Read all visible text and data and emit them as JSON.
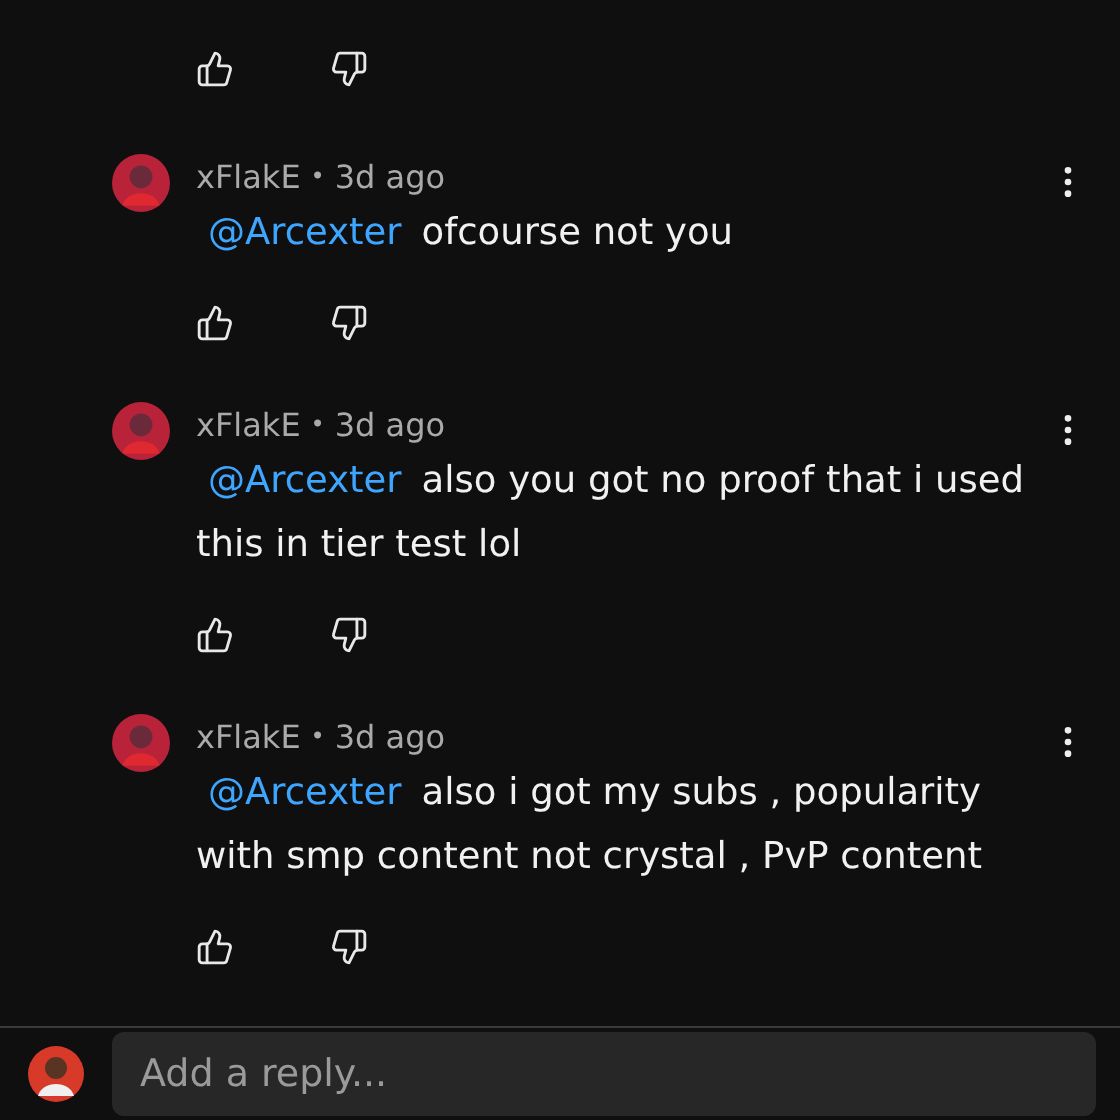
{
  "comments": [
    {
      "author": "xFlakE",
      "separator": "•",
      "time": "3d ago",
      "mention": "@Arcexter",
      "text": "ofcourse not you"
    },
    {
      "author": "xFlakE",
      "separator": "•",
      "time": "3d ago",
      "mention": "@Arcexter",
      "text": "also you got no proof that i used this in tier test lol"
    },
    {
      "author": "xFlakE",
      "separator": "•",
      "time": "3d ago",
      "mention": "@Arcexter",
      "text": "also i got my subs , popularity with smp content not crystal , PvP content"
    }
  ],
  "reply_box": {
    "placeholder": "Add a reply..."
  }
}
